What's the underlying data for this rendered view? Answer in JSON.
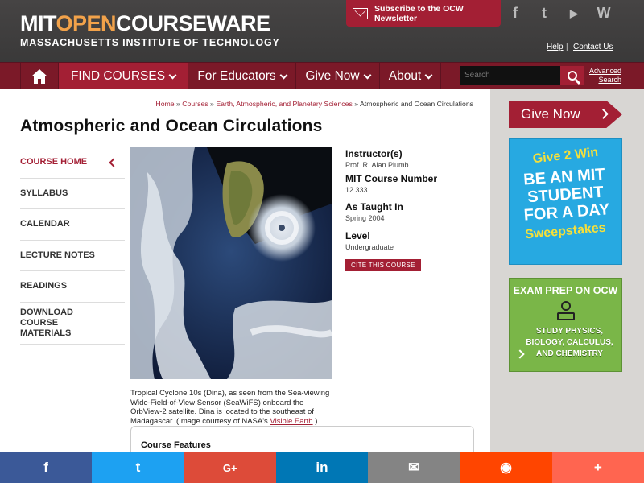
{
  "header": {
    "logo": {
      "mit": "MIT",
      "open": "OPEN",
      "courseware": "COURSEWARE",
      "subtitle": "MASSACHUSETTS INSTITUTE OF TECHNOLOGY"
    },
    "subscribe_label": "Subscribe to the OCW Newsletter",
    "social": [
      {
        "icon": "facebook-icon",
        "glyph": "f"
      },
      {
        "icon": "twitter-icon",
        "glyph": "t"
      },
      {
        "icon": "youtube-icon",
        "glyph": "▶"
      },
      {
        "icon": "wordpress-icon",
        "glyph": "W"
      }
    ],
    "help_label": "Help",
    "separator": "|",
    "contact_label": "Contact Us"
  },
  "nav": {
    "find_courses": "FIND COURSES",
    "educators": "For Educators",
    "give_now": "Give Now",
    "about": "About",
    "search_placeholder": "Search",
    "advanced_search": "Advanced Search"
  },
  "breadcrumb": {
    "home": "Home",
    "sep": " » ",
    "courses": "Courses",
    "department": "Earth, Atmospheric, and Planetary Sciences",
    "current": "Atmospheric and Ocean Circulations"
  },
  "page_title": "Atmospheric and Ocean Circulations",
  "sidebar": {
    "items": [
      {
        "label": "COURSE HOME"
      },
      {
        "label": "SYLLABUS"
      },
      {
        "label": "CALENDAR"
      },
      {
        "label": "LECTURE NOTES"
      },
      {
        "label": "READINGS"
      },
      {
        "label": "DOWNLOAD COURSE MATERIALS"
      }
    ]
  },
  "caption": {
    "text": "Tropical Cyclone 10s (Dina), as seen from the Sea-viewing Wide-Field-of-View Sensor (SeaWiFS) onboard the OrbView-2 satellite. Dina is located to the southeast of Madagascar. (Image courtesy of NASA's ",
    "link": "Visible Earth",
    "end": ".)"
  },
  "info": {
    "instructor_h": "Instructor(s)",
    "instructor_v": "Prof. R. Alan Plumb",
    "number_h": "MIT Course Number",
    "number_v": "12.333",
    "taught_h": "As Taught In",
    "taught_v": "Spring 2004",
    "level_h": "Level",
    "level_v": "Undergraduate",
    "cite_label": "CITE THIS COURSE"
  },
  "features_heading": "Course Features",
  "right": {
    "give_now": "Give Now",
    "promo1": {
      "line1": "Give 2 Win",
      "line2": "BE AN MIT STUDENT FOR A DAY",
      "line3": "Sweepstakes"
    },
    "promo2": {
      "title": "EXAM PREP ON OCW",
      "body": "STUDY PHYSICS, BIOLOGY, CALCULUS, AND CHEMISTRY"
    }
  },
  "sharebar": [
    {
      "icon": "facebook-share-icon",
      "glyph": "f",
      "color": "#3b5998"
    },
    {
      "icon": "twitter-share-icon",
      "glyph": "t",
      "color": "#1da1f2"
    },
    {
      "icon": "googleplus-share-icon",
      "glyph": "G+",
      "color": "#dd4b39"
    },
    {
      "icon": "linkedin-share-icon",
      "glyph": "in",
      "color": "#0077b5"
    },
    {
      "icon": "email-share-icon",
      "glyph": "✉",
      "color": "#848484"
    },
    {
      "icon": "reddit-share-icon",
      "glyph": "◉",
      "color": "#ff4500"
    },
    {
      "icon": "more-share-icon",
      "glyph": "+",
      "color": "#ff6550"
    }
  ],
  "colors": {
    "brand": "#a31f34",
    "nav": "#7b1928",
    "header": "#3d3d3d"
  }
}
